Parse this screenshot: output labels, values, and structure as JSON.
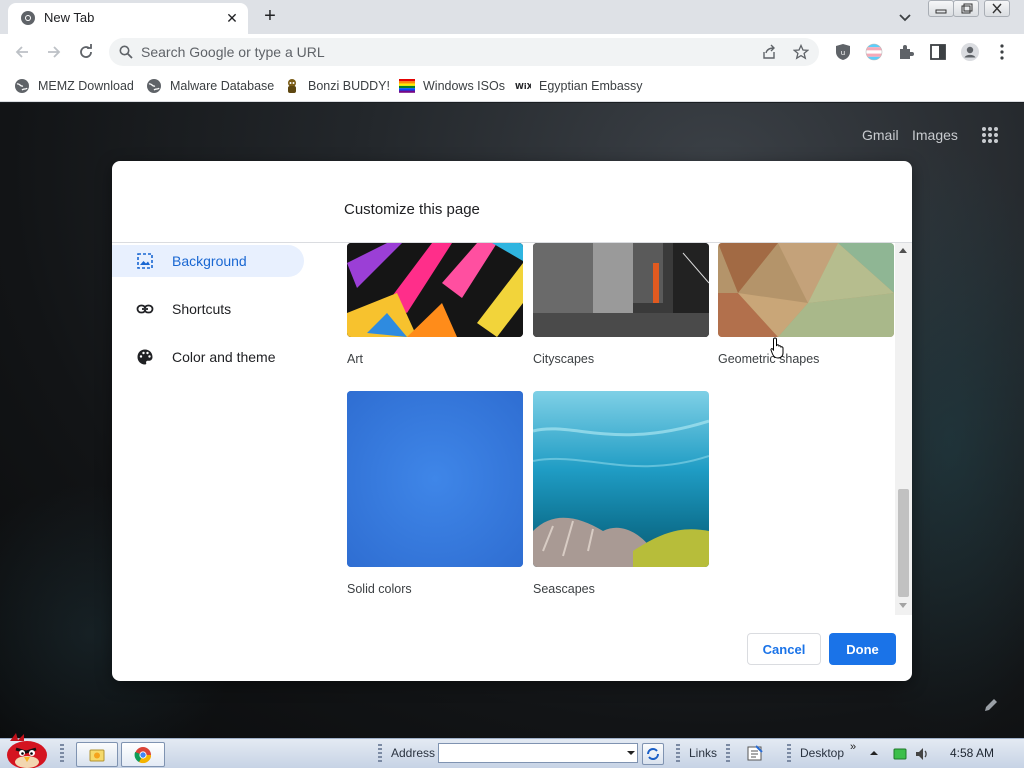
{
  "browser": {
    "tab": {
      "title": "New Tab"
    },
    "omnibox": {
      "placeholder": "Search Google or type a URL"
    },
    "bookmarks": [
      {
        "label": "MEMZ Download",
        "icon": "globe-icon"
      },
      {
        "label": "Malware Database",
        "icon": "globe-icon"
      },
      {
        "label": "Bonzi BUDDY!",
        "icon": "bonzi-icon"
      },
      {
        "label": "Windows ISOs",
        "icon": "windows-flag-icon"
      },
      {
        "label": "Egyptian Embassy",
        "icon": "wix-icon"
      }
    ]
  },
  "page": {
    "gmail": "Gmail",
    "images": "Images"
  },
  "dialog": {
    "title": "Customize this page",
    "menu": [
      {
        "label": "Background",
        "icon": "image-icon",
        "selected": true
      },
      {
        "label": "Shortcuts",
        "icon": "link-icon",
        "selected": false
      },
      {
        "label": "Color and theme",
        "icon": "palette-icon",
        "selected": false
      }
    ],
    "tiles": [
      {
        "label": "Art"
      },
      {
        "label": "Cityscapes"
      },
      {
        "label": "Geometric shapes"
      },
      {
        "label": "Solid colors"
      },
      {
        "label": "Seascapes"
      }
    ],
    "cancel": "Cancel",
    "done": "Done",
    "accent": "#1a73e8"
  },
  "taskbar": {
    "address_label": "Address",
    "links_label": "Links",
    "desktop_label": "Desktop",
    "clock": "4:58 AM"
  }
}
